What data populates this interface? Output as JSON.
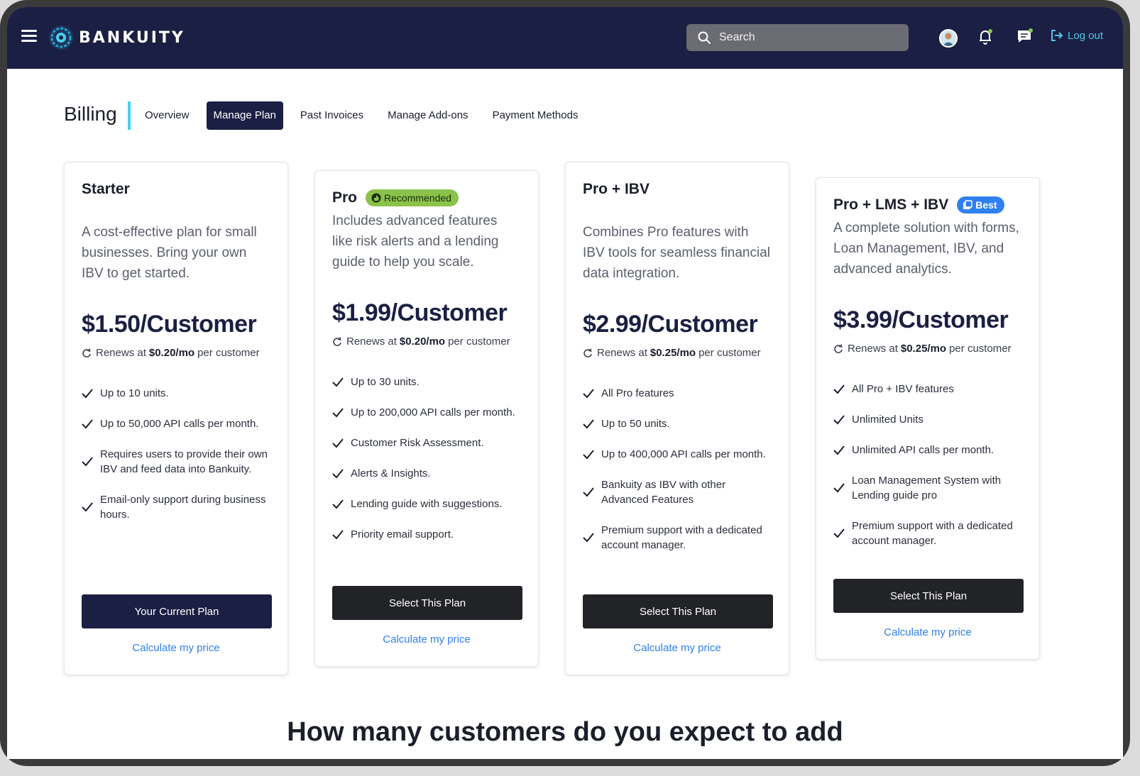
{
  "header": {
    "brand": "BANKUITY",
    "search_placeholder": "Search",
    "logout_label": "Log out"
  },
  "billing": {
    "title": "Billing",
    "tabs": [
      {
        "label": "Overview",
        "active": false
      },
      {
        "label": "Manage Plan",
        "active": true
      },
      {
        "label": "Past Invoices",
        "active": false
      },
      {
        "label": "Manage Add-ons",
        "active": false
      },
      {
        "label": "Payment Methods",
        "active": false
      }
    ]
  },
  "plans": [
    {
      "name": "Starter",
      "badge": "",
      "description": "A cost-effective plan for small businesses. Bring your own IBV to get started.",
      "price": "$1.50/Customer",
      "renew_prefix": "Renews at",
      "renew_amount": "$0.20/mo",
      "renew_suffix": "per customer",
      "features": [
        "Up to 10 units.",
        "Up to 50,000 API calls per month.",
        "Requires users to provide their own IBV and feed data into Bankuity.",
        "Email-only support during business hours."
      ],
      "button_label": "Your Current Plan",
      "calc_label": "Calculate my price"
    },
    {
      "name": "Pro",
      "badge": "Recommended",
      "description": "Includes advanced features like risk alerts and a lending guide to help you scale.",
      "price": "$1.99/Customer",
      "renew_prefix": "Renews at",
      "renew_amount": "$0.20/mo",
      "renew_suffix": "per customer",
      "features": [
        "Up to 30 units.",
        "Up to 200,000 API calls per month.",
        "Customer Risk Assessment.",
        "Alerts & Insights.",
        "Lending guide with suggestions.",
        "Priority email support."
      ],
      "button_label": "Select This Plan",
      "calc_label": "Calculate my price"
    },
    {
      "name": "Pro + IBV",
      "badge": "",
      "description": "Combines Pro features with IBV tools for seamless financial data integration.",
      "price": "$2.99/Customer",
      "renew_prefix": "Renews at",
      "renew_amount": "$0.25/mo",
      "renew_suffix": "per customer",
      "features": [
        "All Pro features",
        "Up to 50 units.",
        "Up to 400,000 API calls per month.",
        "Bankuity as IBV with other Advanced Features",
        "Premium support with a dedicated account manager."
      ],
      "button_label": "Select This Plan",
      "calc_label": "Calculate my price"
    },
    {
      "name": "Pro + LMS + IBV",
      "badge": "Best",
      "description": "A complete solution with forms, Loan Management, IBV, and advanced analytics.",
      "price": "$3.99/Customer",
      "renew_prefix": "Renews at",
      "renew_amount": "$0.25/mo",
      "renew_suffix": "per customer",
      "features": [
        "All Pro + IBV features",
        "Unlimited Units",
        "Unlimited API calls per month.",
        "Loan Management System with Lending guide pro",
        "Premium support with a dedicated account manager."
      ],
      "button_label": "Select This Plan",
      "calc_label": "Calculate my price"
    }
  ],
  "bottom_heading": "How many customers do you expect to add",
  "colors": {
    "navy": "#1b1f43",
    "accent": "#46d1e9",
    "link": "#2f80ed",
    "recommended": "#8bc34a",
    "best": "#2f80ed"
  }
}
